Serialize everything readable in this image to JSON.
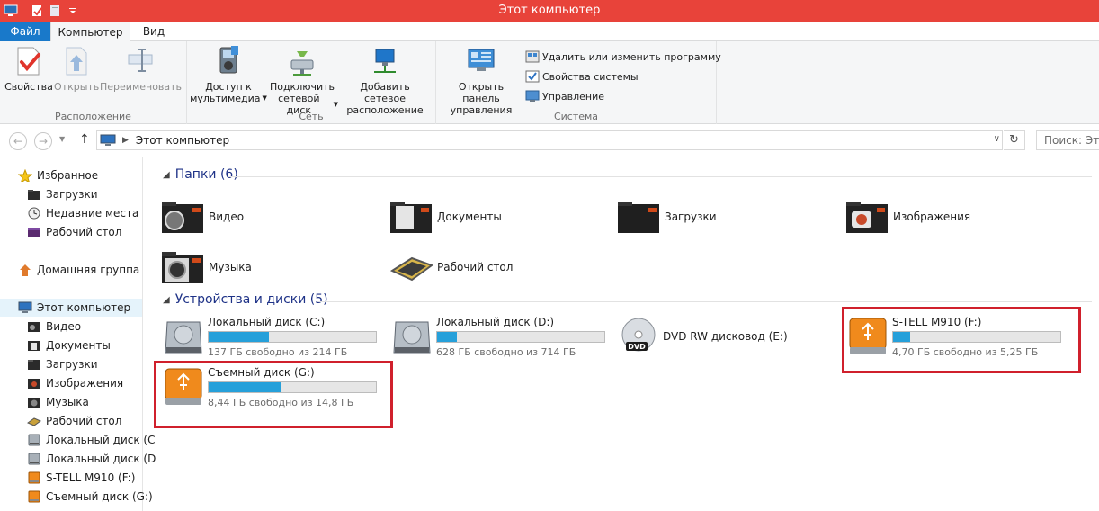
{
  "window": {
    "title": "Этот компьютер",
    "accent": "#e8433a"
  },
  "ribbon": {
    "tabs": [
      "Файл",
      "Компьютер",
      "Вид"
    ],
    "groups": {
      "location": {
        "label": "Расположение",
        "buttons": [
          "Свойства",
          "Открыть",
          "Переименовать"
        ]
      },
      "network": {
        "label": "Сеть",
        "media_l1": "Доступ к",
        "media_l2": "мультимедиа",
        "map_l1": "Подключить",
        "map_l2": "сетевой диск",
        "add_l1": "Добавить сетевое",
        "add_l2": "расположение"
      },
      "system": {
        "label": "Система",
        "panel_l1": "Открыть панель",
        "panel_l2": "управления",
        "small": [
          "Удалить или изменить программу",
          "Свойства системы",
          "Управление"
        ]
      }
    }
  },
  "address": {
    "path": "Этот компьютер",
    "search_placeholder": "Поиск: Этот компьютер"
  },
  "nav": {
    "favorites": "Избранное",
    "fav_items": [
      "Загрузки",
      "Недавние места",
      "Рабочий стол"
    ],
    "homegroup": "Домашняя группа",
    "this_pc": "Этот компьютер",
    "pc_items": [
      "Видео",
      "Документы",
      "Загрузки",
      "Изображения",
      "Музыка",
      "Рабочий стол",
      "Локальный диск (C",
      "Локальный диск (D",
      "S-TELL M910 (F:)",
      "Съемный диск (G:)"
    ]
  },
  "main": {
    "folders_header": "Папки (6)",
    "folders": [
      "Видео",
      "Документы",
      "Загрузки",
      "Изображения",
      "Музыка",
      "Рабочий стол"
    ],
    "devices_header": "Устройства и диски (5)",
    "drives": [
      {
        "name": "Локальный диск (C:)",
        "free": "137 ГБ свободно из 214 ГБ",
        "used_fraction": 0.36
      },
      {
        "name": "Локальный диск (D:)",
        "free": "628 ГБ свободно из 714 ГБ",
        "used_fraction": 0.12
      },
      {
        "name": "DVD RW дисковод (E:)"
      },
      {
        "name": "S-TELL M910 (F:)",
        "free": "4,70 ГБ свободно из 5,25 ГБ",
        "used_fraction": 0.1
      },
      {
        "name": "Съемный диск (G:)",
        "free": "8,44 ГБ свободно из 14,8 ГБ",
        "used_fraction": 0.43
      }
    ]
  }
}
